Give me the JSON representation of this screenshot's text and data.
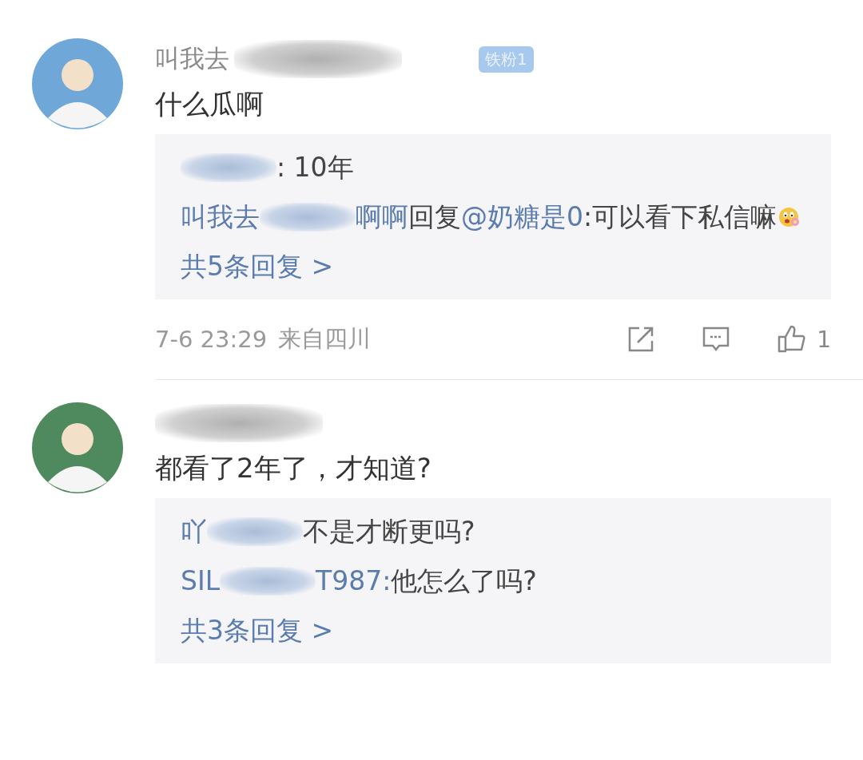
{
  "comments": [
    {
      "name": [
        {
          "kind": "name",
          "text": "叫我去"
        },
        {
          "kind": "redacted"
        }
      ],
      "badge": "铁粉1",
      "content": "什么瓜啊",
      "replies": [
        {
          "segments": [
            {
              "kind": "redacted"
            },
            {
              "kind": "text",
              "text": ": 10年"
            }
          ]
        },
        {
          "segments": [
            {
              "kind": "name",
              "text": "叫我去"
            },
            {
              "kind": "redacted"
            },
            {
              "kind": "name",
              "text": "啊啊"
            },
            {
              "kind": "text",
              "text": "回复"
            },
            {
              "kind": "mention",
              "text": "@奶糖是0"
            },
            {
              "kind": "text",
              "text": ":可以看下私信嘛"
            },
            {
              "kind": "emoji"
            }
          ]
        }
      ],
      "more": "共5条回复 >",
      "time": "7-6 23:29",
      "location": "来自四川",
      "likes": "1"
    },
    {
      "name": [
        {
          "kind": "redacted"
        }
      ],
      "content": "都看了2年了，才知道?",
      "replies": [
        {
          "segments": [
            {
              "kind": "name",
              "text": "吖"
            },
            {
              "kind": "redacted"
            },
            {
              "kind": "text",
              "text": "不是才断更吗?"
            }
          ]
        },
        {
          "segments": [
            {
              "kind": "name",
              "text": "SIL"
            },
            {
              "kind": "redacted"
            },
            {
              "kind": "name",
              "text": "T987:"
            },
            {
              "kind": "text",
              "text": " 他怎么了吗?"
            }
          ]
        }
      ],
      "more": "共3条回复 >"
    }
  ]
}
